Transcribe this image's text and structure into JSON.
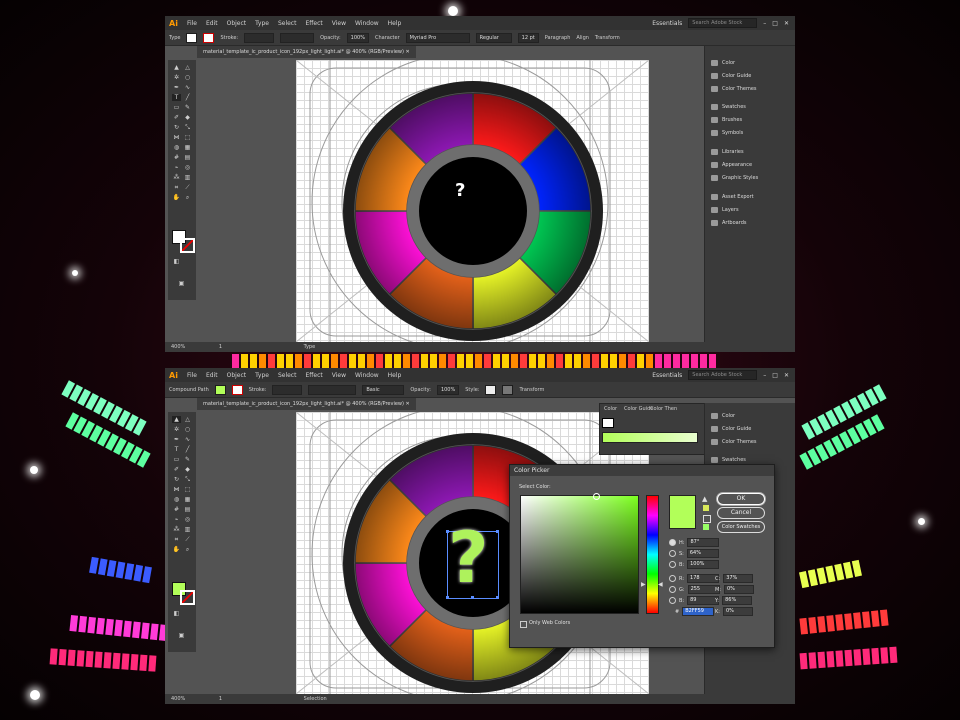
{
  "top": {
    "menu": [
      "File",
      "Edit",
      "Object",
      "Type",
      "Select",
      "Effect",
      "View",
      "Window",
      "Help"
    ],
    "workspace": "Essentials",
    "search_placeholder": "Search Adobe Stock",
    "control": {
      "mode": "Type",
      "stroke_label": "Stroke:",
      "opacity_label": "Opacity:",
      "opacity_value": "100%",
      "character_label": "Character",
      "font": "Myriad Pro",
      "style": "Regular",
      "size": "12 pt",
      "paragraph_label": "Paragraph",
      "align_label": "Align",
      "transform_label": "Transform"
    },
    "doc_tab": "material_template_ic_product_icon_192px_light_light.ai* @ 400% (RGB/Preview)",
    "panels": [
      "Color",
      "Color Guide",
      "Color Themes",
      "Swatches",
      "Brushes",
      "Symbols",
      "Libraries",
      "Appearance",
      "Graphic Styles",
      "Asset Export",
      "Layers",
      "Artboards"
    ],
    "glyph": "?",
    "status": {
      "zoom": "400%",
      "page": "1",
      "tool": "Type"
    }
  },
  "bottom": {
    "menu": [
      "File",
      "Edit",
      "Object",
      "Type",
      "Select",
      "Effect",
      "View",
      "Window",
      "Help"
    ],
    "workspace": "Essentials",
    "search_placeholder": "Search Adobe Stock",
    "control": {
      "mode": "Compound Path",
      "stroke_label": "Stroke:",
      "stroke_style": "Basic",
      "opacity_label": "Opacity:",
      "opacity_value": "100%",
      "style_label": "Style:",
      "transform_label": "Transform"
    },
    "doc_tab": "material_template_ic_product_icon_192px_light_light.ai* @ 400% (RGB/Preview)",
    "panels": [
      "Color",
      "Color Guide",
      "Color Themes",
      "Swatches"
    ],
    "glyph": "?",
    "status": {
      "zoom": "400%",
      "page": "1",
      "tool": "Selection"
    },
    "color_panel_tabs": [
      "Color",
      "Color Guide",
      "Color Then"
    ]
  },
  "color_picker": {
    "title": "Color Picker",
    "select_label": "Select Color:",
    "ok": "OK",
    "cancel": "Cancel",
    "swatches": "Color Swatches",
    "only_web": "Only Web Colors",
    "hsb": [
      {
        "label": "H:",
        "value": "87°"
      },
      {
        "label": "S:",
        "value": "64%"
      },
      {
        "label": "B:",
        "value": "100%"
      }
    ],
    "rgb": [
      {
        "label": "R:",
        "value": "178"
      },
      {
        "label": "G:",
        "value": "255"
      },
      {
        "label": "B:",
        "value": "89"
      }
    ],
    "cmyk": [
      {
        "label": "C:",
        "value": "37%"
      },
      {
        "label": "M:",
        "value": "0%"
      },
      {
        "label": "Y:",
        "value": "86%"
      },
      {
        "label": "K:",
        "value": "0%"
      }
    ],
    "hex_label": "#",
    "hex": "B2FF59",
    "new_color": "#b2ff59"
  },
  "wheel_colors": [
    "#ff1a1a",
    "#0024ff",
    "#00c853",
    "#e8f527",
    "#e6621a",
    "#ff10d8",
    "#ff8a1a",
    "#8e18b4"
  ]
}
